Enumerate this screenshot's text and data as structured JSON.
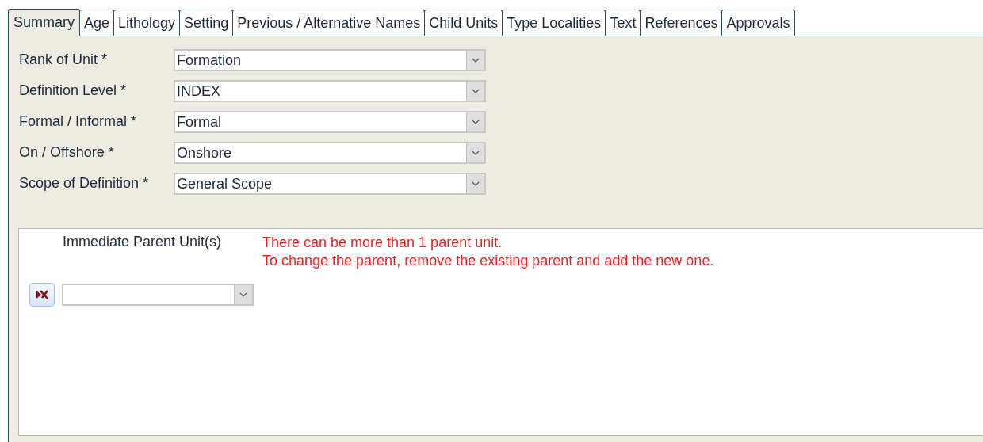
{
  "tabs": [
    {
      "label": "Summary",
      "selected": true
    },
    {
      "label": "Age",
      "selected": false
    },
    {
      "label": "Lithology",
      "selected": false
    },
    {
      "label": "Setting",
      "selected": false
    },
    {
      "label": "Previous / Alternative Names",
      "selected": false
    },
    {
      "label": "Child Units",
      "selected": false
    },
    {
      "label": "Type Localities",
      "selected": false
    },
    {
      "label": "Text",
      "selected": false
    },
    {
      "label": "References",
      "selected": false
    },
    {
      "label": "Approvals",
      "selected": false
    }
  ],
  "fields": [
    {
      "label": "Rank of Unit *",
      "value": "Formation"
    },
    {
      "label": "Definition Level *",
      "value": "INDEX"
    },
    {
      "label": "Formal / Informal *",
      "value": "Formal"
    },
    {
      "label": "On / Offshore *",
      "value": "Onshore"
    },
    {
      "label": "Scope of Definition *",
      "value": "General Scope"
    }
  ],
  "parent_units": {
    "label": "Immediate Parent Unit(s)",
    "notes": [
      "There can be more than 1 parent unit.",
      "To change the parent, remove the existing parent and add the new one."
    ]
  }
}
